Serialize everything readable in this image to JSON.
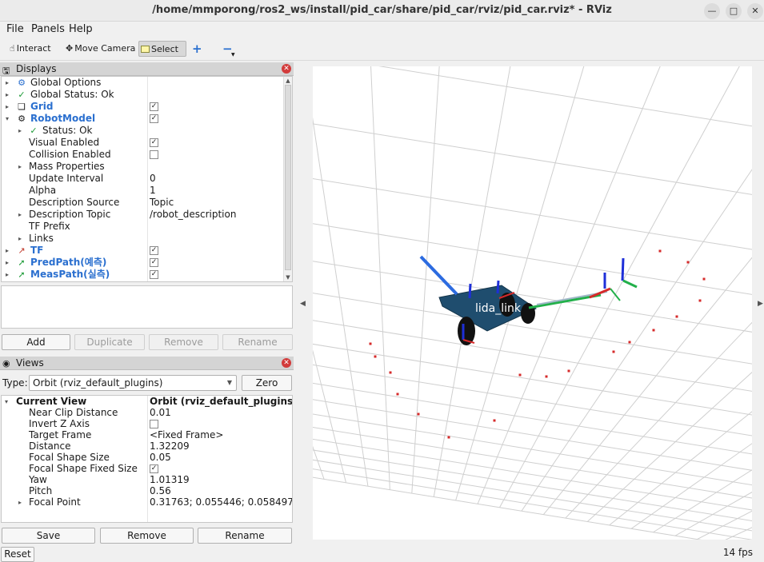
{
  "window": {
    "title": "/home/mmporong/ros2_ws/install/pid_car/share/pid_car/rviz/pid_car.rviz* - RViz",
    "buttons": [
      "minimize-icon",
      "maximize-icon",
      "close-icon"
    ]
  },
  "menu": {
    "file": "File",
    "panels": "Panels",
    "help": "Help"
  },
  "toolbar": {
    "interact": "Interact",
    "move_camera": "Move Camera",
    "select": "Select",
    "active_tool": "Select"
  },
  "displays": {
    "header": "Displays",
    "rows": {
      "global_options": "Global Options",
      "global_status": "Global Status: Ok",
      "grid": "Grid",
      "robot_model": "RobotModel",
      "status_ok": "Status: Ok",
      "visual_enabled": "Visual Enabled",
      "collision_enabled": "Collision Enabled",
      "mass_properties": "Mass Properties",
      "update_interval": "Update Interval",
      "update_interval_value": "0",
      "alpha": "Alpha",
      "alpha_value": "1",
      "description_source": "Description Source",
      "description_source_value": "Topic",
      "description_topic": "Description Topic",
      "description_topic_value": "/robot_description",
      "tf_prefix": "TF Prefix",
      "links": "Links",
      "tf": "TF",
      "pred_path": "PredPath(예측)",
      "meas_path": "MeasPath(실측)"
    },
    "checks": {
      "grid": true,
      "robot_model": true,
      "visual_enabled": true,
      "collision_enabled": false,
      "tf": true,
      "pred_path": true,
      "meas_path": true
    },
    "buttons": {
      "add": "Add",
      "duplicate": "Duplicate",
      "remove": "Remove",
      "rename": "Rename"
    }
  },
  "views": {
    "header": "Views",
    "type_label": "Type:",
    "type_value": "Orbit (rviz_default_plugins)",
    "zero": "Zero",
    "current_view": "Current View",
    "current_view_value": "Orbit (rviz_default_plugins)",
    "props": {
      "near_clip": "Near Clip Distance",
      "near_clip_value": "0.01",
      "invert_z": "Invert Z Axis",
      "target_frame": "Target Frame",
      "target_frame_value": "<Fixed Frame>",
      "distance": "Distance",
      "distance_value": "1.32209",
      "focal_shape_size": "Focal Shape Size",
      "focal_shape_size_value": "0.05",
      "focal_shape_fixed": "Focal Shape Fixed Size",
      "yaw": "Yaw",
      "yaw_value": "1.01319",
      "pitch": "Pitch",
      "pitch_value": "0.56",
      "focal_point": "Focal Point",
      "focal_point_value": "0.31763; 0.055446; 0.058497"
    },
    "checks": {
      "invert_z": false,
      "focal_shape_fixed": true
    },
    "buttons": {
      "save": "Save",
      "remove": "Remove",
      "rename": "Rename"
    }
  },
  "reset": "Reset",
  "viewport": {
    "link_label": "lida_link"
  },
  "fps": "14 fps",
  "colors": {
    "accent_blue": "#2a6fcf",
    "status_green": "#1b9a35",
    "path_red": "#d62a2a",
    "robot_body": "#1f4d6e",
    "grid_line": "#cfcfcf"
  }
}
